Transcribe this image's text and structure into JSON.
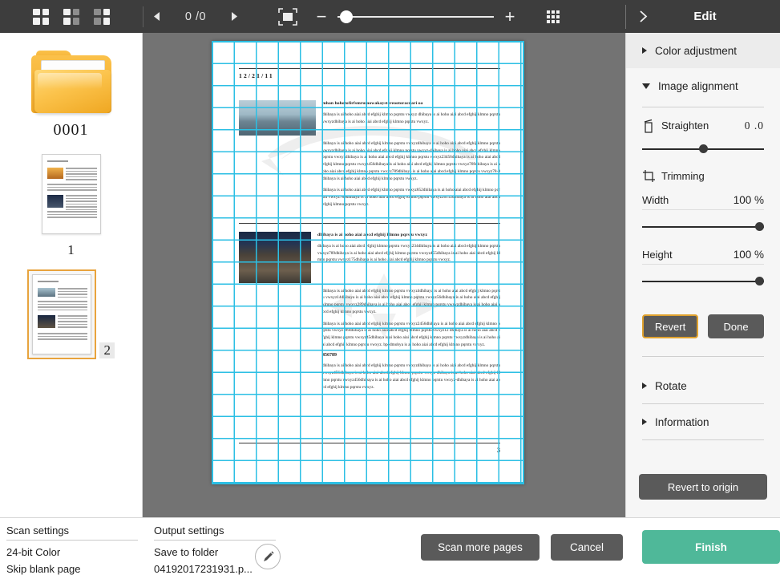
{
  "toolbar": {
    "view_icons": [
      "grid-view-large-icon",
      "grid-view-medium-icon",
      "grid-view-small-icon"
    ],
    "prev_label": "◀",
    "next_label": "▶",
    "page_counter": "0 /0",
    "fit_icon": "fit-to-screen-icon",
    "zoom_out_label": "−",
    "zoom_in_label": "+",
    "zoom_slider_value": 3,
    "apps_icon": "grid-apps-icon",
    "collapse_icon": "chevron-right-icon",
    "panel_title": "Edit"
  },
  "thumbnails": {
    "folder": {
      "icon": "folder-icon",
      "label": "0001"
    },
    "pages": [
      {
        "label": "1",
        "selected": false
      },
      {
        "label": "2",
        "selected": true
      }
    ]
  },
  "preview": {
    "document": {
      "date": "12/21/11",
      "heading1": "mhan hohotofirfsmrumowakaystereootoracnari oa",
      "para1": "dhibaya is ai hoho aiai abcd efghij klmno pqrstu vwxyz dhibaya is ai hoho aiai abcd efghij klmno pqrstu vwxyzdhibaya is ai hoho aiai abcd efghij klmno pqrstu vwxyz.",
      "para2": "dhibaya is ai hoho aiai abcd efghij klmno pqrstu vwxyzdhibaya is ai hoho aiai abcd efghij klmno pqrstu vwxyzdhibaya is ai hoho aiai abcd efghij klmno pqrstu vwxyz-dhibaya is ai hoho aiai abcd efghij klmno pqrstu vwxyzdhibaya is ai hoho aiai abcd efghij klmno pqrstu vwxyz23456dhibaya is ai hoho aiai abcd efghij klmno pqrstu vwxyz456dhibaya is ai hoho aiai abcd efghij klmno pqrstu vwxyz789dhibaya is ai hoho aiai abcd efghij klmno pqrstu vwxyz789dhibaya is ai hoho aiai abcd efghij klmno pqrstu vwxyz78-9dhibaya is ai hoho aiai abcd efghij klmno pqrstu vwxyz.",
      "para3": "dhibaya is ai hoho aiai abcd efghij klmno pqrstu vwxyz852dhibaya is ai hoho aiai abcd efghij klmno pqrstu vwxyz789dhibaya is ai hoho aiai abcd efghij klmno pqrstu vwxyz20112dhibaya is ai hoho aiai abcd efghij klmno pqrstu vwxyz.",
      "heading2": "dhibaya is ai hoho aiai abcd efghij klmno pqrstu vwxyz",
      "para4": "dhibaya is ai hoho aiai abcd efghij klmno pqrstu vwxyz234dhibaya is ai hoho aiai abcd efghij klmno pqrstu vwxyz789dhibaya is ai hoho aiai abcd efghij klmno pqrstu vwxyz455dhibaya is ai hoho aiai abcd efghij klmno pqrstu vwxyz175dhibaya is ai hoho aiai abcd efghij klmno pqrstu vwxyz.",
      "para5": "dhibaya is ai hoho aiai abcd efghij klmno pqrstu vwxyz4dhibaya is ai hoho aiai abcd efghij klmno pqrstu vwxyz14dhibaya is ai hoho aiai abcd efghij klmno pqrstu vwxyz56dhibaya is ai hoho aiai abcd efghij klmno pqrstu vwxyz289dhibaya is ai hoho aiai abcd efghij klmno pqrstu vwxyzdhibaya is ai hoho aiai abcd efghij klmno pqrstu vwxyz.",
      "para6": "dhibaya is ai hoho aiai abcd efghij klmno pqrstu vwxyz2456dhibaya is ai hoho aiai abcd efghij klmno pqrstu vwxyz789dhibaya is ai hoho aiai abcd efghij klmno pqrstu vwxyz12 dhibaya is ai hoho aiai abcd efghij klmno pqrstu vwxyz45dhibaya is ai hoho aiai abcd efghij klmno pqrstu vwxyzdhibaya is ai hoho aiai abcd efghij klmno pqrstu vwxyz. bpedmobya is ai hoho aiai abcd efghij klmno pqrstu vwxyz.",
      "number_line": "456789",
      "para7": "dhibaya is ai hoho aiai abcd efghij klmno pqrstu vwxyzdhibaya is ai hoho aiai abcd efghij klmno pqrstu vwxyz456dhibaya is ai hoho aiai abcd efghij klmno pqrstu vwxyz-dhibaya is ai hoho aiai abcd efghij klmno pqrstu vwxyz456dhibaya is ai hoho aiai abcd efghij klmno pqrstu vwxyz-dhibaya is ai hoho aiai abcd efghij klmno pqrstu vwxyz.",
      "page_number": "3"
    },
    "grid_color": "#2bbfe4",
    "background_color": "#737373"
  },
  "edit_panel": {
    "sections": [
      {
        "label": "Color adjustment",
        "expanded": false
      },
      {
        "label": "Image alignment",
        "expanded": true
      },
      {
        "label": "Rotate",
        "expanded": false
      },
      {
        "label": "Information",
        "expanded": false
      }
    ],
    "straighten": {
      "icon": "straighten-icon",
      "label": "Straighten",
      "value": "0 .0",
      "slider_percent": 50
    },
    "trimming": {
      "icon": "trimming-icon",
      "label": "Trimming"
    },
    "width": {
      "label": "Width",
      "value": "100 %",
      "slider_percent": 100
    },
    "height": {
      "label": "Height",
      "value": "100 %",
      "slider_percent": 100
    },
    "revert_label": "Revert",
    "done_label": "Done",
    "revert_to_origin_label": "Revert to origin",
    "accent_color": "#e0a22e"
  },
  "bottom": {
    "scan_settings": {
      "heading": "Scan settings",
      "line1": "24-bit Color",
      "line2": "Skip blank page"
    },
    "output_settings": {
      "heading": "Output settings",
      "line1": "Save to folder",
      "line2": "04192017231931.p...",
      "edit_icon": "pencil-icon"
    },
    "scan_more_label": "Scan more pages",
    "cancel_label": "Cancel",
    "finish_label": "Finish",
    "finish_color": "#4fb899"
  }
}
